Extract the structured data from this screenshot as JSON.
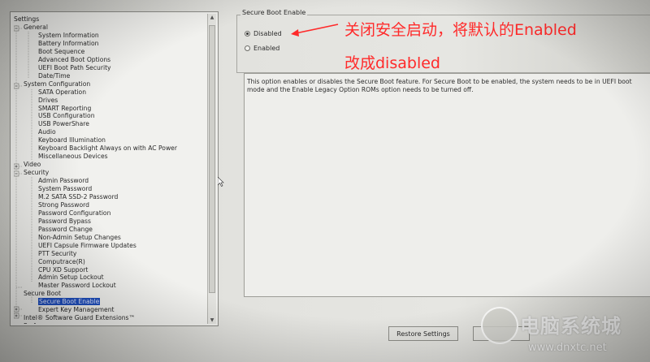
{
  "tree": {
    "title": "Settings",
    "items": [
      {
        "label": "General",
        "level": 1
      },
      {
        "label": "System Information",
        "level": 2
      },
      {
        "label": "Battery Information",
        "level": 2
      },
      {
        "label": "Boot Sequence",
        "level": 2
      },
      {
        "label": "Advanced Boot Options",
        "level": 2
      },
      {
        "label": "UEFI Boot Path Security",
        "level": 2
      },
      {
        "label": "Date/Time",
        "level": 2
      },
      {
        "label": "System Configuration",
        "level": 1
      },
      {
        "label": "SATA Operation",
        "level": 2
      },
      {
        "label": "Drives",
        "level": 2
      },
      {
        "label": "SMART Reporting",
        "level": 2
      },
      {
        "label": "USB Configuration",
        "level": 2
      },
      {
        "label": "USB PowerShare",
        "level": 2
      },
      {
        "label": "Audio",
        "level": 2
      },
      {
        "label": "Keyboard Illumination",
        "level": 2
      },
      {
        "label": "Keyboard Backlight Always on with AC Power",
        "level": 2
      },
      {
        "label": "Miscellaneous Devices",
        "level": 2
      },
      {
        "label": "Video",
        "level": 1
      },
      {
        "label": "Security",
        "level": 1
      },
      {
        "label": "Admin Password",
        "level": 2
      },
      {
        "label": "System Password",
        "level": 2
      },
      {
        "label": "M.2 SATA SSD-2 Password",
        "level": 2
      },
      {
        "label": "Strong Password",
        "level": 2
      },
      {
        "label": "Password Configuration",
        "level": 2
      },
      {
        "label": "Password Bypass",
        "level": 2
      },
      {
        "label": "Password Change",
        "level": 2
      },
      {
        "label": "Non-Admin Setup Changes",
        "level": 2
      },
      {
        "label": "UEFI Capsule Firmware Updates",
        "level": 2
      },
      {
        "label": "PTT Security",
        "level": 2
      },
      {
        "label": "Computrace(R)",
        "level": 2
      },
      {
        "label": "CPU XD Support",
        "level": 2
      },
      {
        "label": "Admin Setup Lockout",
        "level": 2
      },
      {
        "label": "Master Password Lockout",
        "level": 2
      },
      {
        "label": "Secure Boot",
        "level": 1
      },
      {
        "label": "Secure Boot Enable",
        "level": 2,
        "selected": true
      },
      {
        "label": "Expert Key Management",
        "level": 2
      },
      {
        "label": "Intel® Software Guard Extensions™",
        "level": 1
      },
      {
        "label": "Performance",
        "level": 1
      }
    ]
  },
  "group": {
    "title": "Secure Boot Enable",
    "options": [
      {
        "label": "Disabled",
        "checked": true
      },
      {
        "label": "Enabled",
        "checked": false
      }
    ]
  },
  "description": "This option enables or disables the Secure Boot feature. For Secure Boot to be enabled, the system needs to be in UEFI boot mode and the Enable Legacy Option ROMs option needs to be turned off.",
  "buttons": {
    "restore": "Restore Settings"
  },
  "annotation": {
    "line1": "关闭安全启动，将默认的Enabled",
    "line2": "改成disabled",
    "color": "#ff2a2a"
  },
  "watermark": {
    "title": "电脑系统城",
    "url": "www.dnxtc.net"
  }
}
